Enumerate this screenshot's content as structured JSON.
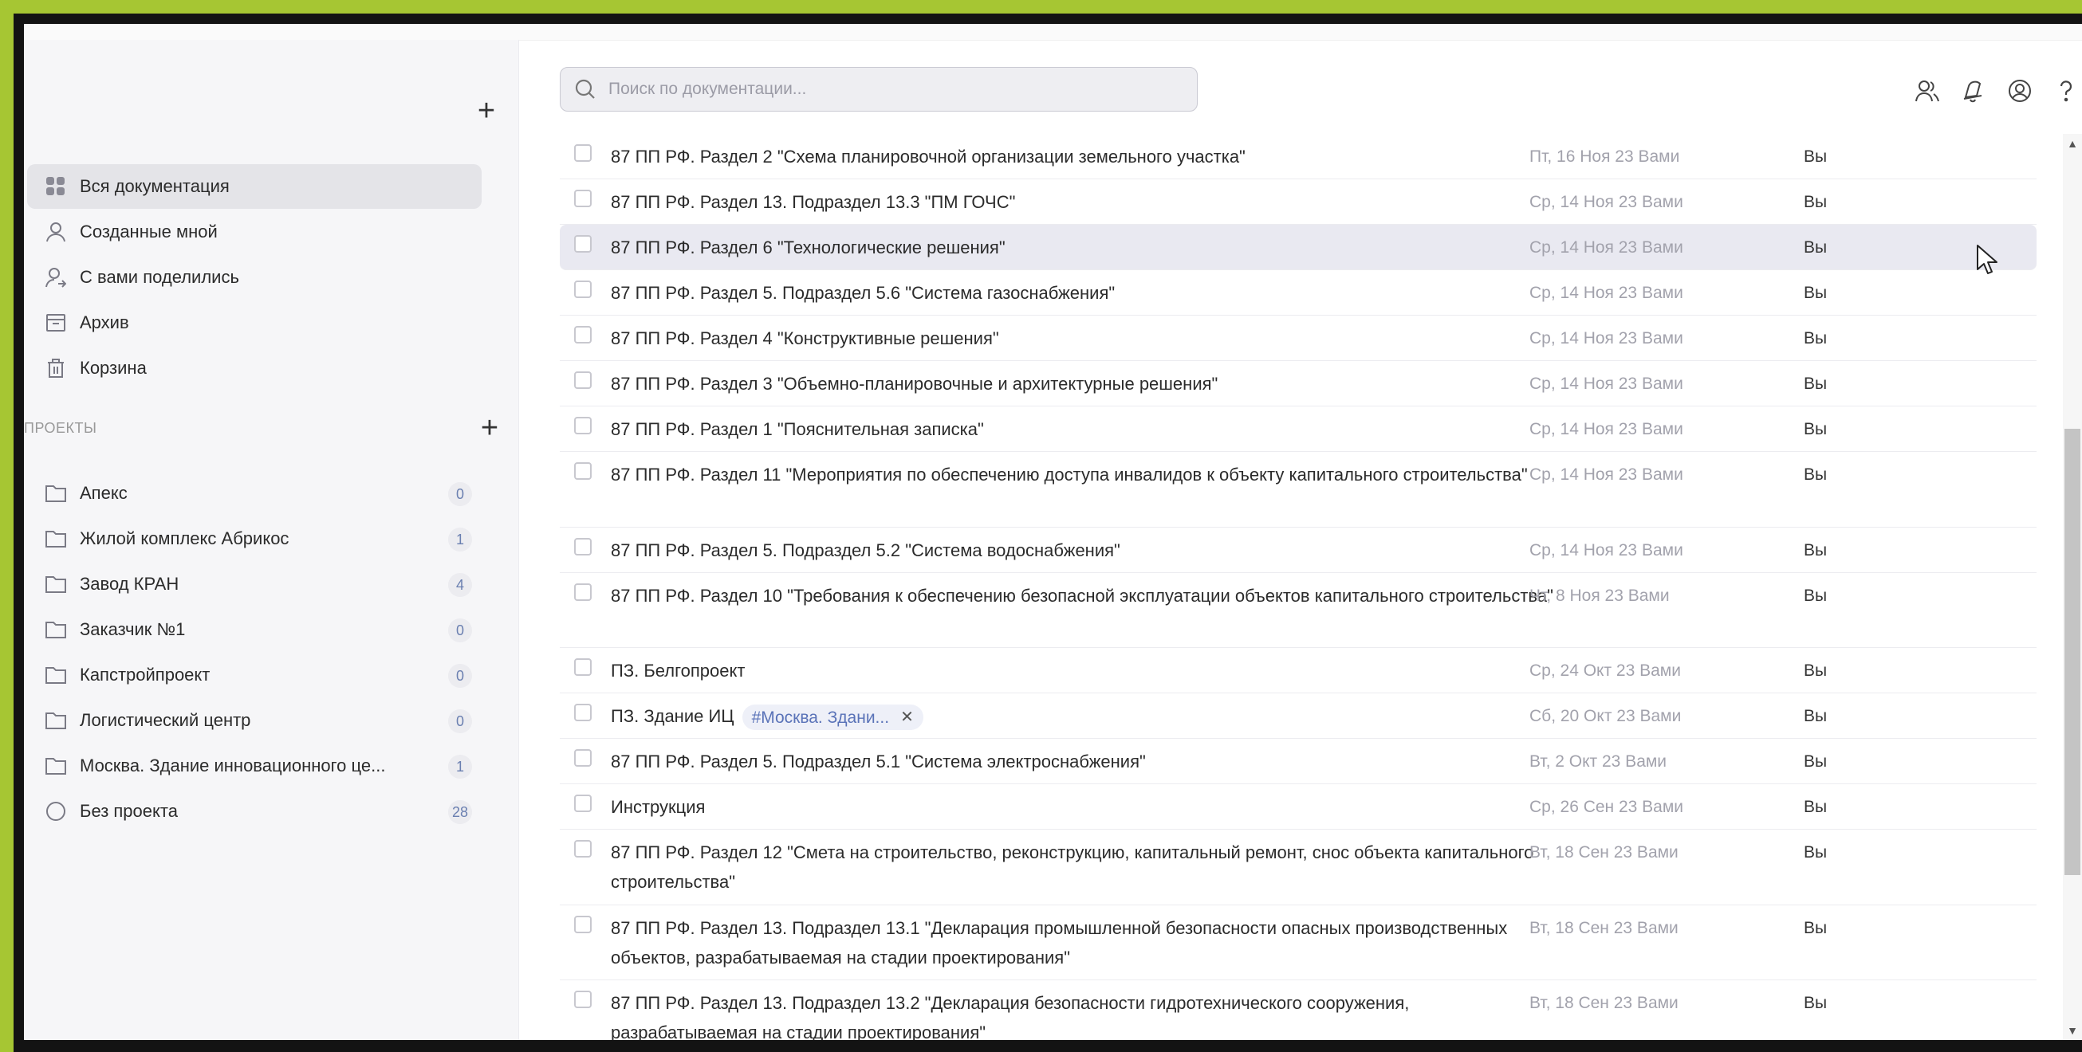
{
  "search": {
    "placeholder": "Поиск по документации..."
  },
  "sidebar": {
    "nav": [
      {
        "label": "Вся документация",
        "icon": "grid-icon",
        "active": true
      },
      {
        "label": "Созданные мной",
        "icon": "user-icon"
      },
      {
        "label": "С вами поделились",
        "icon": "user-share-icon"
      },
      {
        "label": "Архив",
        "icon": "archive-icon"
      },
      {
        "label": "Корзина",
        "icon": "trash-icon"
      }
    ],
    "projects_label": "ПРОЕКТЫ",
    "projects": [
      {
        "label": "Апекс",
        "count": "0"
      },
      {
        "label": "Жилой комплекс Абрикос",
        "count": "1"
      },
      {
        "label": "Завод КРАН",
        "count": "4"
      },
      {
        "label": "Заказчик №1",
        "count": "0"
      },
      {
        "label": "Капстройпроект",
        "count": "0"
      },
      {
        "label": "Логистический центр",
        "count": "0"
      },
      {
        "label": "Москва. Здание инновационного це...",
        "count": "1"
      },
      {
        "label": "Без проекта",
        "count": "28"
      }
    ]
  },
  "header_icons": [
    "users-icon",
    "notifications-icon",
    "account-icon",
    "help-icon"
  ],
  "documents": [
    {
      "title": "87 ПП РФ. Раздел 2 \"Схема планировочной организации земельного участка\"",
      "date": "Пт, 16 Ноя 23 Вами",
      "owner": "Вы"
    },
    {
      "title": "87 ПП РФ. Раздел 13. Подраздел 13.3 \"ПМ ГОЧС\"",
      "date": "Ср, 14 Ноя 23 Вами",
      "owner": "Вы"
    },
    {
      "title": "87 ПП РФ. Раздел 6 \"Технологические решения\"",
      "date": "Ср, 14 Ноя 23 Вами",
      "owner": "Вы"
    },
    {
      "title": "87 ПП РФ. Раздел 5. Подраздел 5.6 \"Система газоснабжения\"",
      "date": "Ср, 14 Ноя 23 Вами",
      "owner": "Вы"
    },
    {
      "title": "87 ПП РФ. Раздел 4 \"Конструктивные решения\"",
      "date": "Ср, 14 Ноя 23 Вами",
      "owner": "Вы"
    },
    {
      "title": "87 ПП РФ. Раздел 3 \"Объемно-планировочные и архитектурные решения\"",
      "date": "Ср, 14 Ноя 23 Вами",
      "owner": "Вы"
    },
    {
      "title": "87 ПП РФ. Раздел 1 \"Пояснительная записка\"",
      "date": "Ср, 14 Ноя 23 Вами",
      "owner": "Вы"
    },
    {
      "title": "87 ПП РФ. Раздел 11 \"Мероприятия по обеспечению доступа инвалидов к объекту капитального строительства\"",
      "date": "Ср, 14 Ноя 23 Вами",
      "owner": "Вы"
    },
    {
      "title": "87 ПП РФ. Раздел 5. Подраздел 5.2 \"Система водоснабжения\"",
      "date": "Ср, 14 Ноя 23 Вами",
      "owner": "Вы"
    },
    {
      "title": "87 ПП РФ. Раздел 10 \"Требования к обеспечению безопасной эксплуатации объектов капитального строительства\"",
      "date": "Чт, 8 Ноя 23 Вами",
      "owner": "Вы"
    },
    {
      "title": "ПЗ. Белгопроект",
      "date": "Ср, 24 Окт 23 Вами",
      "owner": "Вы"
    },
    {
      "title": "ПЗ. Здание ИЦ",
      "tag": "#Москва. Здани...",
      "date": "Сб, 20 Окт 23 Вами",
      "owner": "Вы"
    },
    {
      "title": "87 ПП РФ. Раздел 5. Подраздел 5.1 \"Система электроснабжения\"",
      "date": "Вт, 2 Окт 23 Вами",
      "owner": "Вы"
    },
    {
      "title": "Инструкция",
      "date": "Ср, 26 Сен 23 Вами",
      "owner": "Вы"
    },
    {
      "title": "87 ПП РФ. Раздел 12 \"Смета на строительство, реконструкцию, капитальный ремонт, снос объекта капитального строительства\"",
      "date": "Вт, 18 Сен 23 Вами",
      "owner": "Вы"
    },
    {
      "title": "87 ПП РФ. Раздел 13. Подраздел 13.1 \"Декларация промышленной безопасности опасных производственных объектов, разрабатываемая на стадии проектирования\"",
      "date": "Вт, 18 Сен 23 Вами",
      "owner": "Вы"
    },
    {
      "title": "87 ПП РФ. Раздел 13. Подраздел 13.2 \"Декларация безопасности гидротехнического сооружения, разрабатываемая на стадии проектирования\"",
      "date": "Вт, 18 Сен 23 Вами",
      "owner": "Вы"
    }
  ]
}
